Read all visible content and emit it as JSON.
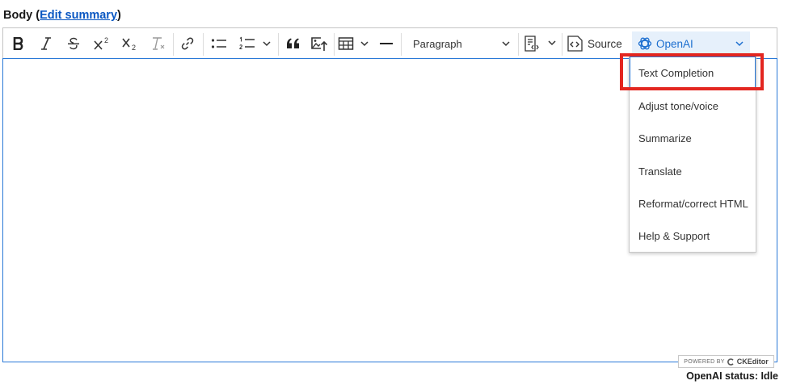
{
  "field": {
    "label_prefix": "Body (",
    "link": "Edit summary",
    "label_suffix": ")"
  },
  "toolbar": {
    "paragraph_select": "Paragraph",
    "source_label": "Source",
    "openai_label": "OpenAI",
    "subscript_sample": "2",
    "superscript_sample": "2"
  },
  "dropdown": {
    "items": [
      "Text Completion",
      "Adjust tone/voice",
      "Summarize",
      "Translate",
      "Reformat/correct HTML",
      "Help & Support"
    ]
  },
  "footer": {
    "powered_by": "POWERED BY",
    "ckeditor": "CKEditor",
    "status": "OpenAI status: Idle"
  },
  "colors": {
    "accent": "#2a79d7",
    "highlight": "#e32620",
    "openai_bg": "#e6f0fb"
  }
}
